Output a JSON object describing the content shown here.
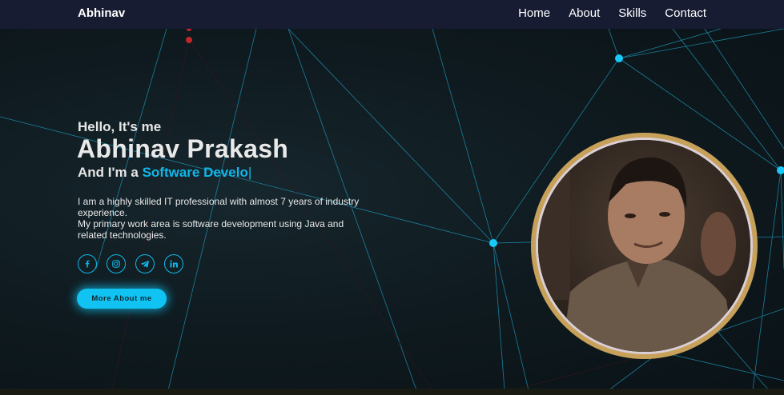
{
  "nav": {
    "brand": "Abhinav",
    "links": [
      "Home",
      "About",
      "Skills",
      "Contact"
    ]
  },
  "hero": {
    "greeting": "Hello, It's me",
    "name": "Abhinav Prakash",
    "role_prefix": "And I'm a",
    "role_typed": "Software Develo",
    "cursor": "|",
    "bio_lines": [
      "I am a highly skilled IT professional with almost 7 years of industry experience.",
      "My primary work area is software development using Java and related technologies."
    ],
    "socials": [
      "facebook-icon",
      "instagram-icon",
      "telegram-icon",
      "linkedin-icon"
    ],
    "cta_label": "More About me"
  },
  "colors": {
    "accent": "#0fb7ea",
    "nav_bg": "#171c33",
    "ring": "#c7a05a",
    "background": "#0b1519"
  }
}
